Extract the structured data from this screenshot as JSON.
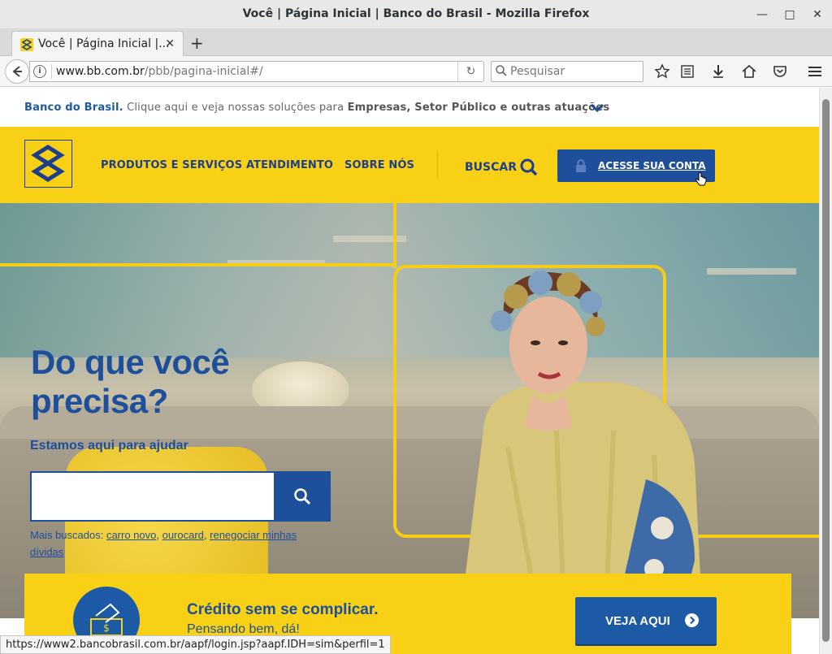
{
  "window": {
    "title": "Você | Página Inicial | Banco do Brasil - Mozilla Firefox"
  },
  "tab": {
    "title": "Você | Página Inicial |..."
  },
  "nav": {
    "url_host": "www.bb.com.br",
    "url_path": "/pbb/pagina-inicial#/",
    "search_placeholder": "Pesquisar"
  },
  "topstrip": {
    "brand": "Banco do Brasil.",
    "text": " Clique aqui e veja nossas soluções para ",
    "strong": "Empresas, Setor Público e outras atuações"
  },
  "header": {
    "nav_items": [
      "PRODUTOS E SERVIÇOS",
      "ATENDIMENTO",
      "SOBRE NÓS"
    ],
    "buscar": "BUSCAR",
    "acesse": "ACESSE SUA CONTA"
  },
  "hero": {
    "title_line1": "Do que você",
    "title_line2": "precisa?",
    "subtitle": "Estamos aqui para ajudar",
    "mais_label": "Mais buscados: ",
    "mais_links": [
      "carro novo",
      "ourocard",
      "renegociar minhas dívidas"
    ]
  },
  "credit": {
    "title": "Crédito sem se complicar.",
    "subtitle": "Pensando bem, dá!",
    "button": "VEJA AQUI"
  },
  "status": {
    "url": "https://www2.bancobrasil.com.br/aapf/login.jsp?aapf.IDH=sim&perfil=1"
  },
  "colors": {
    "bb_yellow": "#f8d117",
    "bb_blue": "#1d4f9b"
  }
}
